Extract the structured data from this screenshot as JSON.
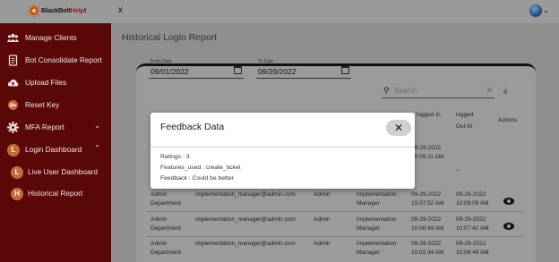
{
  "topbar": {
    "logo_prefix": "BlackBelt",
    "logo_highlight": "Help",
    "logo_suffix": "!",
    "close_label": "x"
  },
  "sidebar": {
    "items": [
      {
        "label": "Manage Clients",
        "icon": "users-icon"
      },
      {
        "label": "Bot Consolidate Report",
        "icon": "document-icon"
      },
      {
        "label": "Upload Files",
        "icon": "cloud-upload-icon"
      },
      {
        "label": "Reset Key",
        "icon": "key-icon"
      },
      {
        "label": "MFA Report",
        "icon": "gear-icon"
      },
      {
        "label": "Login Dashboard",
        "icon": "l-circle-icon",
        "badge": "L"
      },
      {
        "label": "Live User Dashboard",
        "icon": "l-circle-icon",
        "badge": "L"
      },
      {
        "label": "Historical Report",
        "icon": "h-circle-icon",
        "badge": "H"
      }
    ],
    "accent": "#5a0707"
  },
  "main": {
    "title": "Historical Login Report",
    "from_date": {
      "label": "From Date",
      "value": "09/01/2022"
    },
    "to_date": {
      "label": "To Date",
      "value": "09/29/2022"
    },
    "search_placeholder": "Search",
    "headers": {
      "logged_in": [
        "logged In"
      ],
      "logged_out": [
        "logged",
        "Out At"
      ],
      "actions": "Actions"
    },
    "rows": [
      {
        "name": "",
        "email": "",
        "role": "",
        "department": "",
        "in": [
          "09-29-2022",
          "10:09:11 AM"
        ],
        "out": [
          "--"
        ]
      },
      {
        "name": [
          "Admin",
          "Department"
        ],
        "email": "implementation_manager@admin.com",
        "role": "Admin",
        "department": [
          "Implementation",
          "Manager"
        ],
        "in": [
          "09-29-2022",
          "10:07:52 AM"
        ],
        "out": [
          "09-29-2022",
          "10:09:05 AM"
        ]
      },
      {
        "name": [
          "Admin",
          "Department"
        ],
        "email": "implementation_manager@admin.com",
        "role": "Admin",
        "department": [
          "Implementation",
          "Manager"
        ],
        "in": [
          "09-29-2022",
          "10:06:49 AM"
        ],
        "out": [
          "09-29-2022",
          "10:07:42 AM"
        ]
      },
      {
        "name": [
          "Admin",
          "Department"
        ],
        "email": "implementation_manager@admin.com",
        "role": "Admin",
        "department": [
          "Implementation",
          "Manager"
        ],
        "in": [
          "09-29-2022",
          "10:02:34 AM"
        ],
        "out": [
          "09-29-2022",
          "10:06:49 AM"
        ]
      }
    ]
  },
  "modal": {
    "title": "Feedback Data",
    "close_label": "✕",
    "lines": [
      "Ratings : 3",
      "Features_used : create_ticket",
      "Feedback : Could be better"
    ]
  }
}
